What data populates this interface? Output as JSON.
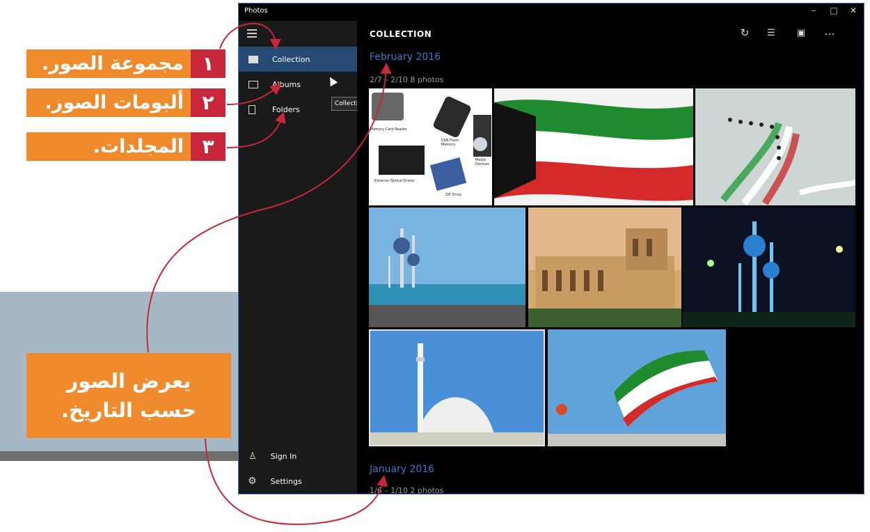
{
  "app": {
    "title": "Photos",
    "window_controls": {
      "minimize": "–",
      "maximize": "□",
      "close": "✕"
    }
  },
  "annotations": {
    "labels": [
      {
        "num": "١",
        "text": "مجموعة الصور."
      },
      {
        "num": "٢",
        "text": "ألبومات الصور."
      },
      {
        "num": "٣",
        "text": "المجلدات."
      }
    ],
    "description": {
      "line1": "يعرض الصور",
      "line2": "حسب التاريخ."
    }
  },
  "sidebar": {
    "items": [
      {
        "label": "Collection",
        "icon": "photos-icon",
        "selected": true
      },
      {
        "label": "Albums",
        "icon": "album-icon",
        "selected": false
      },
      {
        "label": "Folders",
        "icon": "folder-icon",
        "selected": false
      }
    ],
    "bottom": [
      {
        "label": "Sign In",
        "icon": "person-icon"
      },
      {
        "label": "Settings",
        "icon": "gear-icon"
      }
    ],
    "tooltip": "Collection"
  },
  "content": {
    "title": "COLLECTION",
    "groups": [
      {
        "month": "February 2016",
        "range": "2/7 – 2/10   8 photos"
      },
      {
        "month": "January 2016",
        "range": "1/6 – 1/10   2 photos"
      }
    ],
    "photos": [
      {
        "name": "photo-storage-devices",
        "labels": [
          "Memory Card Reader",
          "USB Flash Memory",
          "Media Devices",
          "External Optical Drives",
          "ZIP Drive"
        ]
      },
      {
        "name": "photo-kuwait-flag"
      },
      {
        "name": "photo-air-show"
      },
      {
        "name": "photo-kuwait-towers-day"
      },
      {
        "name": "photo-palace-building"
      },
      {
        "name": "photo-kuwait-towers-night"
      },
      {
        "name": "photo-mosque"
      },
      {
        "name": "photo-flag-kite"
      }
    ]
  },
  "colors": {
    "accent": "#3a78c6",
    "orange": "#ef8b2c",
    "red": "#c8263b",
    "arrow": "#c8263b"
  }
}
